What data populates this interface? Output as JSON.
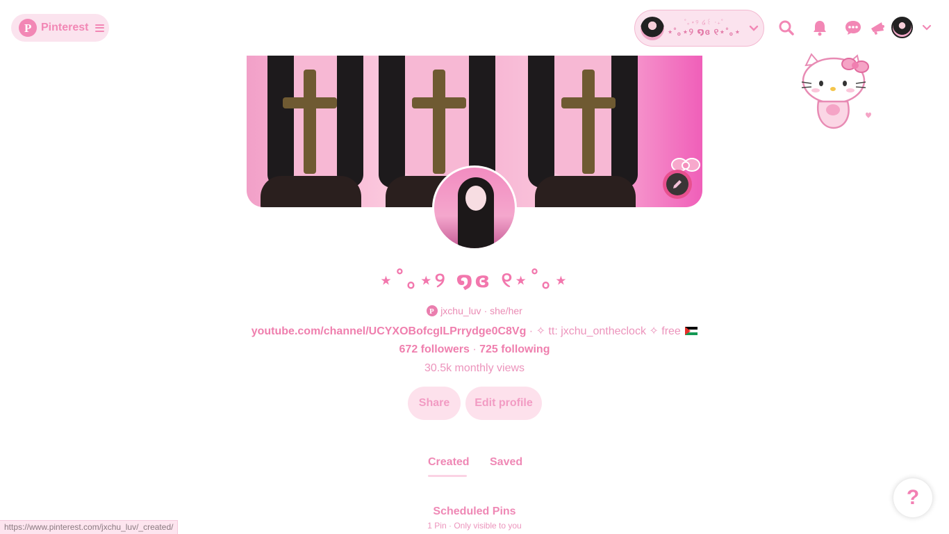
{
  "header": {
    "logo_label": "Pinterest",
    "account": {
      "small_name": "˚｡⋆୨ ໒꒰ ‧₊˚",
      "display_name": "⋆˚｡⋆୨ ໑ɞ ୧⋆˚｡⋆"
    },
    "icons": [
      "search-icon",
      "bell-icon",
      "message-icon",
      "megaphone-icon"
    ]
  },
  "profile": {
    "display_name": "⋆˚｡⋆୨ ໑ɞ ୧⋆˚｡⋆",
    "handle": "jxchu_luv",
    "pronouns": " · she/her",
    "bio_link": "youtube.com/channel/UCYXOBofcgILPrrydge0C8Vg",
    "bio_text": " · ✧ tt: jxchu_ontheclock ✧ free ",
    "followers": "672 followers",
    "separator": " · ",
    "following": "725 following",
    "monthly_views": "30.5k monthly views",
    "share_label": "Share",
    "edit_label": "Edit profile"
  },
  "tabs": {
    "created": "Created",
    "saved": "Saved",
    "active": "Created"
  },
  "scheduled": {
    "title": "Scheduled Pins",
    "subtitle": "1 Pin · Only visible to you"
  },
  "help_label": "?",
  "status_url": "https://www.pinterest.com/jxchu_luv/_created/",
  "colors": {
    "accent": "#f287b5",
    "pill_bg": "#fbe3ee",
    "text_pink": "#ef7fae"
  }
}
